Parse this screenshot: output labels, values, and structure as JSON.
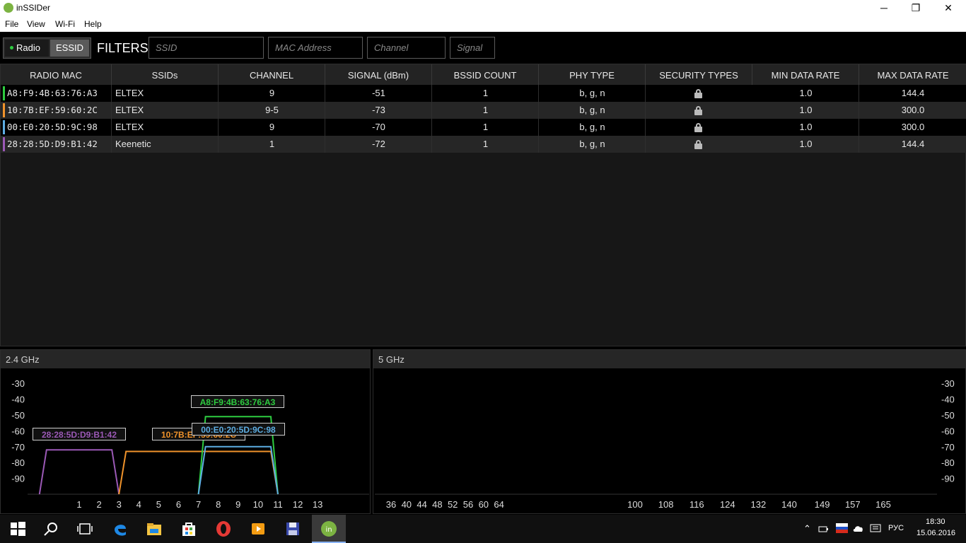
{
  "window": {
    "title": "inSSIDer",
    "minimize": "─",
    "restore": "❐",
    "close": "✕"
  },
  "menu": [
    "File",
    "View",
    "Wi-Fi",
    "Help"
  ],
  "toolbar": {
    "radio_label": "Radio",
    "essid_label": "ESSID",
    "filters_label": "FILTERS:",
    "placeholders": {
      "ssid": "SSID",
      "mac": "MAC Address",
      "channel": "Channel",
      "signal": "Signal"
    }
  },
  "grid": {
    "columns": [
      "RADIO MAC",
      "SSIDs",
      "CHANNEL",
      "SIGNAL (dBm)",
      "BSSID COUNT",
      "PHY TYPE",
      "SECURITY TYPES",
      "MIN DATA RATE",
      "MAX DATA RATE"
    ],
    "rows": [
      {
        "color": "#2ecc40",
        "mac": "A8:F9:4B:63:76:A3",
        "ssid": "ELTEX",
        "channel": "9",
        "signal": "-51",
        "bssid": "1",
        "phy": "b, g, n",
        "security": "lock-icon",
        "min": "1.0",
        "max": "144.4"
      },
      {
        "color": "#f0932b",
        "mac": "10:7B:EF:59:60:2C",
        "ssid": "ELTEX",
        "channel": "9-5",
        "signal": "-73",
        "bssid": "1",
        "phy": "b, g, n",
        "security": "lock-icon",
        "min": "1.0",
        "max": "300.0"
      },
      {
        "color": "#5dade2",
        "mac": "00:E0:20:5D:9C:98",
        "ssid": "ELTEX",
        "channel": "9",
        "signal": "-70",
        "bssid": "1",
        "phy": "b, g, n",
        "security": "lock-icon",
        "min": "1.0",
        "max": "300.0"
      },
      {
        "color": "#9b59b6",
        "mac": "28:28:5D:D9:B1:42",
        "ssid": "Keenetic",
        "channel": "1",
        "signal": "-72",
        "bssid": "1",
        "phy": "b, g, n",
        "security": "lock-icon",
        "min": "1.0",
        "max": "144.4"
      }
    ]
  },
  "chart_data": [
    {
      "type": "area",
      "title": "2.4 GHz",
      "ylim": [
        -100,
        -25
      ],
      "y_ticks": [
        "-30",
        "-40",
        "-50",
        "-60",
        "-70",
        "-80",
        "-90"
      ],
      "x_ticks": [
        "1",
        "2",
        "3",
        "4",
        "5",
        "6",
        "7",
        "8",
        "9",
        "10",
        "11",
        "12",
        "13"
      ],
      "series": [
        {
          "name": "A8:F9:4B:63:76:A3",
          "color": "#2ecc40",
          "channel_from": 7,
          "channel_to": 11,
          "signal": -51
        },
        {
          "name": "10:7B:EF:59:60:2C",
          "color": "#f0932b",
          "channel_from": 3,
          "channel_to": 11,
          "signal": -73
        },
        {
          "name": "00:E0:20:5D:9C:98",
          "color": "#5dade2",
          "channel_from": 7,
          "channel_to": 11,
          "signal": -70
        },
        {
          "name": "28:28:5D:D9:B1:42",
          "color": "#9b59b6",
          "channel_from": -1,
          "channel_to": 3,
          "signal": -72
        }
      ]
    },
    {
      "type": "area",
      "title": "5 GHz",
      "ylim": [
        -100,
        -25
      ],
      "y_ticks": [
        "-30",
        "-40",
        "-50",
        "-60",
        "-70",
        "-80",
        "-90"
      ],
      "x_ticks": [
        "36",
        "40",
        "44",
        "48",
        "52",
        "56",
        "60",
        "64",
        "100",
        "108",
        "116",
        "124",
        "132",
        "140",
        "149",
        "157",
        "165"
      ],
      "series": []
    }
  ],
  "taskbar": {
    "lang": "РУС",
    "time": "18:30",
    "date": "15.06.2016"
  }
}
